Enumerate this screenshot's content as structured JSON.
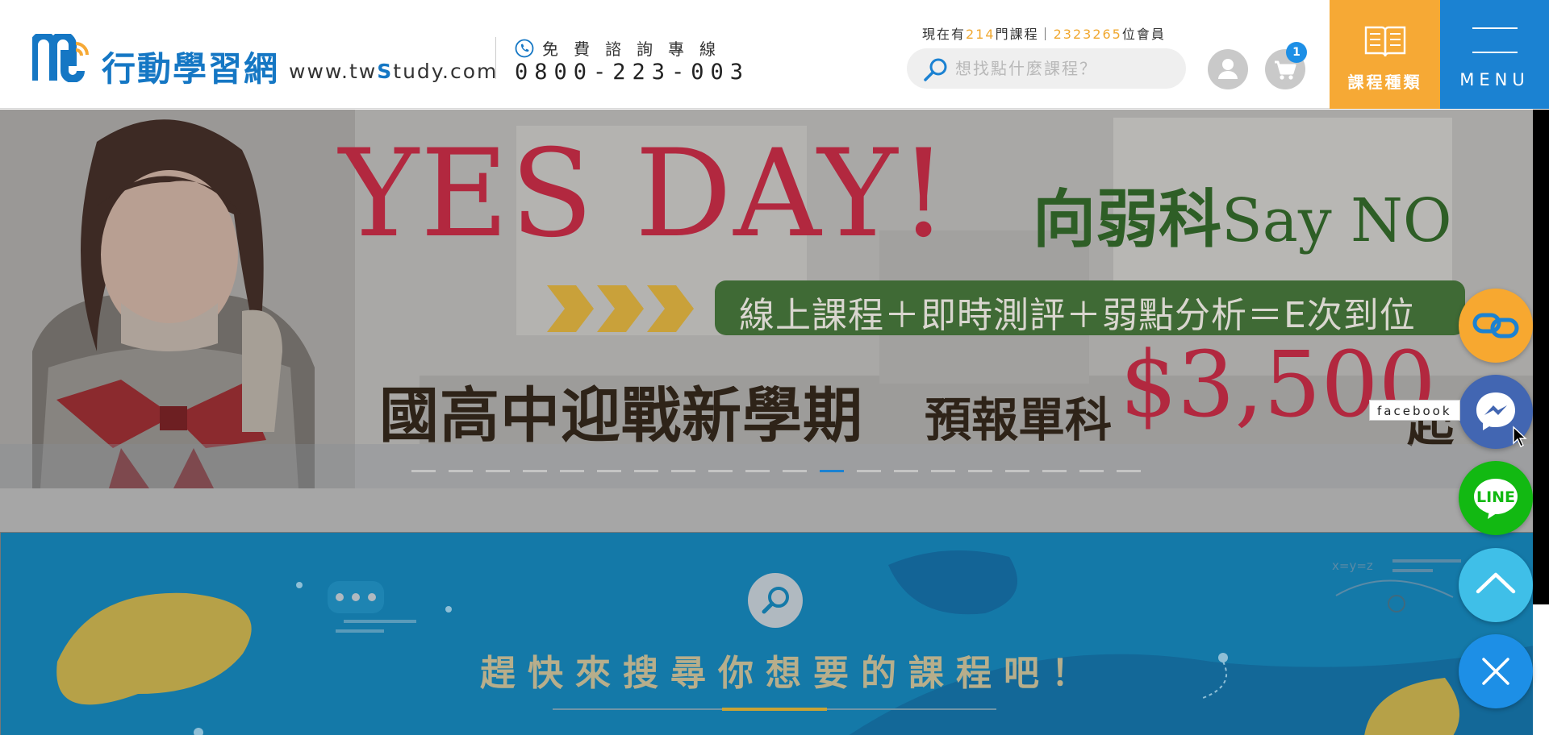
{
  "header": {
    "logo_cn": "行動學習網",
    "logo_url_pre": "www.tw",
    "logo_url_s": "S",
    "logo_url_post": "tudy.com",
    "phone_label": "免費諮詢專線",
    "phone_number": "0800-223-003",
    "stats": {
      "prefix": "現在有",
      "courses": "214",
      "courses_suffix": "門課程",
      "sep": "｜",
      "members": "2323265",
      "members_suffix": "位會員"
    },
    "search_placeholder": "想找點什麼課程？",
    "cart_count": "1",
    "course_types_label": "課程種類",
    "menu_label": "MENU"
  },
  "banner": {
    "headline": "YES DAY!",
    "slogan_cn": "向弱科",
    "slogan_en": "Say NO",
    "formula": "線上課程＋即時測評＋弱點分析＝E次到位",
    "promo_left": "國高中迎戰新學期",
    "promo_mid": "預報單科",
    "promo_price": "$3,500",
    "promo_suffix": "起",
    "slide_count": 20,
    "active_slide": 11
  },
  "search_section": {
    "title": "趕快來搜尋你想要的課程吧！",
    "deco_formula": "x=y=z"
  },
  "side_buttons": {
    "facebook_tooltip": "facebook"
  },
  "colors": {
    "brand_blue": "#1b82d2",
    "brand_orange": "#f6a935",
    "headline_red": "#b2283f",
    "line_green": "#12b912",
    "messenger_blue": "#4266b2",
    "section_blue": "#1479a8"
  },
  "icons": [
    "phone-icon",
    "search-icon",
    "user-icon",
    "cart-icon",
    "book-icon",
    "link-icon",
    "messenger-icon",
    "line-icon",
    "chevron-up-icon",
    "close-icon"
  ]
}
